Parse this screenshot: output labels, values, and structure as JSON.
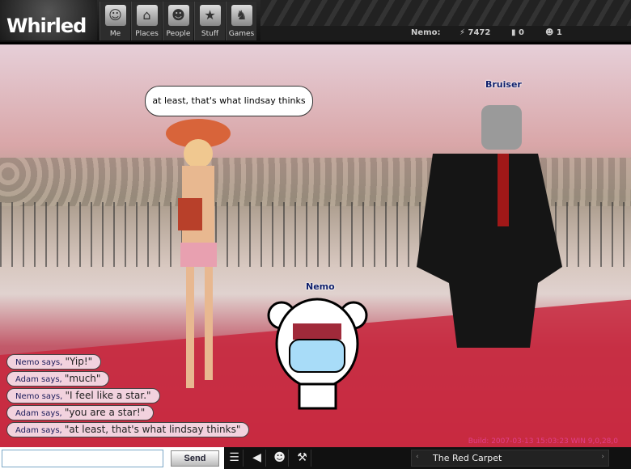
{
  "header": {
    "logo": "Whirled",
    "nav": [
      {
        "label": "Me",
        "icon": "me-icon"
      },
      {
        "label": "Places",
        "icon": "places-icon"
      },
      {
        "label": "People",
        "icon": "people-icon"
      },
      {
        "label": "Stuff",
        "icon": "stuff-icon"
      },
      {
        "label": "Games",
        "icon": "games-icon"
      }
    ],
    "user": "Nemo:",
    "flow": "⚡ 7472",
    "gold": "▮ 0",
    "level": "☻ 1"
  },
  "scene": {
    "speech_bubble": "at least, that's what lindsay thinks",
    "names": {
      "bruiser": "Bruiser",
      "nemo": "Nemo"
    },
    "chat": [
      {
        "who": "Nemo says, ",
        "msg": "\"Yip!\""
      },
      {
        "who": "Adam says, ",
        "msg": "\"much\""
      },
      {
        "who": "Nemo says, ",
        "msg": "\"I feel like a star.\""
      },
      {
        "who": "Adam says, ",
        "msg": "\"you are a star!\""
      },
      {
        "who": "Adam says, ",
        "msg": "\"at least, that's what lindsay thinks\""
      }
    ],
    "build": "Build: 2007-03-13 15:03:23  WIN 9,0,28,0"
  },
  "footer": {
    "input_value": "",
    "send_label": "Send",
    "room": "The Red Carpet"
  }
}
